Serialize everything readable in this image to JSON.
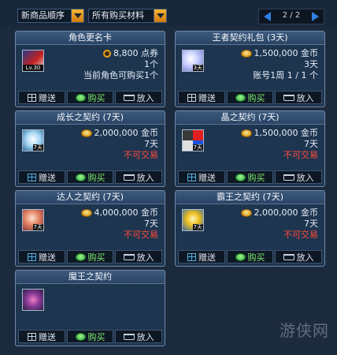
{
  "filters": {
    "sort_label": "新商品顺序",
    "category_label": "所有购买材料"
  },
  "pagination": {
    "text": "2 / 2"
  },
  "buttons": {
    "gift": "赠送",
    "buy": "购买",
    "cart": "放入"
  },
  "items": [
    {
      "title": "角色更名卡",
      "price": "8,800",
      "currency": "点券",
      "qty": "1个",
      "note": "当前角色可购买1个",
      "badge": "Lv.30",
      "price_icon": "cash-icon"
    },
    {
      "title": "王者契约礼包 (3天)",
      "price": "1,500,000",
      "currency": "金币",
      "qty": "3天",
      "note": "账号1周 1 / 1 个",
      "badge": "3天",
      "price_icon": "gold-coin-icon"
    },
    {
      "title": "成长之契约 (7天)",
      "price": "2,000,000",
      "currency": "金币",
      "qty": "7天",
      "note": "不可交易",
      "badge": "7天",
      "price_icon": "gold-coin-icon"
    },
    {
      "title": "晶之契约 (7天)",
      "price": "1,500,000",
      "currency": "金币",
      "qty": "7天",
      "note": "不可交易",
      "badge": "7天",
      "price_icon": "gold-coin-icon"
    },
    {
      "title": "达人之契约 (7天)",
      "price": "4,000,000",
      "currency": "金币",
      "qty": "7天",
      "note": "不可交易",
      "badge": "7天",
      "price_icon": "gold-coin-icon"
    },
    {
      "title": "霸王之契约 (7天)",
      "price": "2,000,000",
      "currency": "金币",
      "qty": "7天",
      "note": "不可交易",
      "badge": "7天",
      "price_icon": "gold-coin-icon"
    },
    {
      "title": "魔王之契约"
    }
  ],
  "watermark": "游侠网",
  "colors": {
    "accent_orange": "#e9a21b",
    "warning_red": "#ff4a3a",
    "buy_green": "#7de86f",
    "pager_blue": "#2f7fe0"
  }
}
